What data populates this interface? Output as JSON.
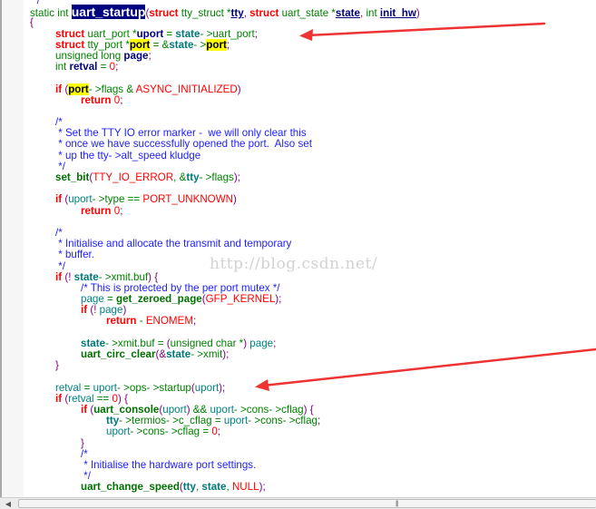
{
  "watermark": "http://blog.csdn.net/",
  "colors": {
    "keyword": "#ff0000",
    "comment": "#2020ff",
    "text": "#008000",
    "identifier": "#008080",
    "highlight": "#ffff00",
    "selection": "#000080",
    "arrow": "#ee3333"
  },
  "scrollbar": {
    "left_arrow_icon": "◀",
    "grip": "|||"
  },
  "code": {
    "lines": [
      [
        [
          "cm",
          " */"
        ]
      ],
      [
        [
          "tx",
          "static int "
        ],
        [
          "sel",
          "uart_startup"
        ],
        [
          "pu",
          "("
        ],
        [
          "kw",
          "struct"
        ],
        [
          "tx",
          " tty_struct *"
        ],
        [
          "ul",
          "tty"
        ],
        [
          "pu",
          ","
        ],
        [
          "tx",
          " "
        ],
        [
          "kw",
          "struct"
        ],
        [
          "tx",
          " uart_state *"
        ],
        [
          "ul",
          "state"
        ],
        [
          "pu",
          ","
        ],
        [
          "tx",
          " int "
        ],
        [
          "ul",
          "init_hw"
        ],
        [
          "pu",
          ")"
        ]
      ],
      [
        [
          "pu",
          "{"
        ]
      ],
      [
        [
          "tx",
          "\t"
        ],
        [
          "kw",
          "struct"
        ],
        [
          "tx",
          " uart_port *"
        ],
        [
          "bid",
          "uport"
        ],
        [
          "tx",
          " = "
        ],
        [
          "bt",
          "state"
        ],
        [
          "tx",
          "- >uart_port"
        ],
        [
          "pu",
          ";"
        ]
      ],
      [
        [
          "tx",
          "\t"
        ],
        [
          "kw",
          "struct"
        ],
        [
          "tx",
          " tty_port *"
        ],
        [
          "hl",
          "port"
        ],
        [
          "tx",
          " = &"
        ],
        [
          "bt",
          "state"
        ],
        [
          "tx",
          "- >"
        ],
        [
          "hl",
          "port"
        ],
        [
          "pu",
          ";"
        ]
      ],
      [
        [
          "tx",
          "\tunsigned long "
        ],
        [
          "bid",
          "page"
        ],
        [
          "pu",
          ";"
        ]
      ],
      [
        [
          "tx",
          "\tint "
        ],
        [
          "bid",
          "retval"
        ],
        [
          "tx",
          " = "
        ],
        [
          "num",
          "0"
        ],
        [
          "pu",
          ";"
        ]
      ],
      [],
      [
        [
          "tx",
          "\t"
        ],
        [
          "kw",
          "if"
        ],
        [
          "tx",
          " "
        ],
        [
          "pu",
          "("
        ],
        [
          "hl",
          "port"
        ],
        [
          "tx",
          "- >flags & "
        ],
        [
          "cst",
          "ASYNC_INITIALIZED"
        ],
        [
          "pu",
          ")"
        ]
      ],
      [
        [
          "tx",
          "\t\t"
        ],
        [
          "kw",
          "return"
        ],
        [
          "tx",
          " "
        ],
        [
          "num",
          "0"
        ],
        [
          "pu",
          ";"
        ]
      ],
      [],
      [
        [
          "cm",
          "\t/*"
        ]
      ],
      [
        [
          "cm",
          "\t * Set the TTY IO error marker -  we will only clear this"
        ]
      ],
      [
        [
          "cm",
          "\t * once we have successfully opened the port.  Also set"
        ]
      ],
      [
        [
          "cm",
          "\t * up the tty- >alt_speed kludge"
        ]
      ],
      [
        [
          "cm",
          "\t */"
        ]
      ],
      [
        [
          "tx",
          "\t"
        ],
        [
          "fn",
          "set_bit"
        ],
        [
          "pu",
          "("
        ],
        [
          "cst",
          "TTY_IO_ERROR"
        ],
        [
          "tx",
          ", &"
        ],
        [
          "bt",
          "tty"
        ],
        [
          "tx",
          "- >flags"
        ],
        [
          "pu",
          ");"
        ]
      ],
      [],
      [
        [
          "tx",
          "\t"
        ],
        [
          "kw",
          "if"
        ],
        [
          "tx",
          " "
        ],
        [
          "pu",
          "("
        ],
        [
          "id",
          "uport"
        ],
        [
          "tx",
          "- >type == "
        ],
        [
          "cst",
          "PORT_UNKNOWN"
        ],
        [
          "pu",
          ")"
        ]
      ],
      [
        [
          "tx",
          "\t\t"
        ],
        [
          "kw",
          "return"
        ],
        [
          "tx",
          " "
        ],
        [
          "num",
          "0"
        ],
        [
          "pu",
          ";"
        ]
      ],
      [],
      [
        [
          "cm",
          "\t/*"
        ]
      ],
      [
        [
          "cm",
          "\t * Initialise and allocate the transmit and temporary"
        ]
      ],
      [
        [
          "cm",
          "\t * buffer."
        ]
      ],
      [
        [
          "cm",
          "\t */"
        ]
      ],
      [
        [
          "tx",
          "\t"
        ],
        [
          "kw",
          "if"
        ],
        [
          "tx",
          " "
        ],
        [
          "pu",
          "(! "
        ],
        [
          "bt",
          "state"
        ],
        [
          "tx",
          "- >xmit.buf"
        ],
        [
          "pu",
          ")"
        ],
        [
          "tx",
          " "
        ],
        [
          "pu",
          "{"
        ]
      ],
      [
        [
          "cm",
          "\t\t/* This is protected by the per port mutex */"
        ]
      ],
      [
        [
          "tx",
          "\t\t"
        ],
        [
          "id",
          "page"
        ],
        [
          "tx",
          " = "
        ],
        [
          "fn",
          "get_zeroed_page"
        ],
        [
          "pu",
          "("
        ],
        [
          "cst",
          "GFP_KERNEL"
        ],
        [
          "pu",
          ");"
        ]
      ],
      [
        [
          "tx",
          "\t\t"
        ],
        [
          "kw",
          "if"
        ],
        [
          "tx",
          " "
        ],
        [
          "pu",
          "(! "
        ],
        [
          "id",
          "page"
        ],
        [
          "pu",
          ")"
        ]
      ],
      [
        [
          "tx",
          "\t\t\t"
        ],
        [
          "kw",
          "return"
        ],
        [
          "tx",
          " - "
        ],
        [
          "cst",
          "ENOMEM"
        ],
        [
          "pu",
          ";"
        ]
      ],
      [],
      [
        [
          "tx",
          "\t\t"
        ],
        [
          "bt",
          "state"
        ],
        [
          "tx",
          "- >xmit.buf = "
        ],
        [
          "pu",
          "("
        ],
        [
          "tx",
          "unsigned char *"
        ],
        [
          "pu",
          ")"
        ],
        [
          "tx",
          " "
        ],
        [
          "id",
          "page"
        ],
        [
          "pu",
          ";"
        ]
      ],
      [
        [
          "tx",
          "\t\t"
        ],
        [
          "fn",
          "uart_circ_clear"
        ],
        [
          "pu",
          "(&"
        ],
        [
          "bt",
          "state"
        ],
        [
          "tx",
          "- >xmit"
        ],
        [
          "pu",
          ");"
        ]
      ],
      [
        [
          "tx",
          "\t"
        ],
        [
          "pu",
          "}"
        ]
      ],
      [],
      [
        [
          "tx",
          "\t"
        ],
        [
          "id",
          "retval"
        ],
        [
          "tx",
          " = "
        ],
        [
          "id",
          "uport"
        ],
        [
          "tx",
          "- >ops- >startup"
        ],
        [
          "pu",
          "("
        ],
        [
          "id",
          "uport"
        ],
        [
          "pu",
          ");"
        ]
      ],
      [
        [
          "tx",
          "\t"
        ],
        [
          "kw",
          "if"
        ],
        [
          "tx",
          " "
        ],
        [
          "pu",
          "("
        ],
        [
          "id",
          "retval"
        ],
        [
          "tx",
          " == "
        ],
        [
          "num",
          "0"
        ],
        [
          "pu",
          ")"
        ],
        [
          "tx",
          " "
        ],
        [
          "pu",
          "{"
        ]
      ],
      [
        [
          "tx",
          "\t\t"
        ],
        [
          "kw",
          "if"
        ],
        [
          "tx",
          " "
        ],
        [
          "pu",
          "("
        ],
        [
          "fn",
          "uart_console"
        ],
        [
          "pu",
          "("
        ],
        [
          "id",
          "uport"
        ],
        [
          "pu",
          ")"
        ],
        [
          "tx",
          " && "
        ],
        [
          "id",
          "uport"
        ],
        [
          "tx",
          "- >cons- >cflag"
        ],
        [
          "pu",
          ")"
        ],
        [
          "tx",
          " "
        ],
        [
          "pu",
          "{"
        ]
      ],
      [
        [
          "tx",
          "\t\t\t"
        ],
        [
          "bt",
          "tty"
        ],
        [
          "tx",
          "- >termios- >c_cflag = "
        ],
        [
          "id",
          "uport"
        ],
        [
          "tx",
          "- >cons- >cflag"
        ],
        [
          "pu",
          ";"
        ]
      ],
      [
        [
          "tx",
          "\t\t\t"
        ],
        [
          "id",
          "uport"
        ],
        [
          "tx",
          "- >cons- >cflag = "
        ],
        [
          "num",
          "0"
        ],
        [
          "pu",
          ";"
        ]
      ],
      [
        [
          "tx",
          "\t\t"
        ],
        [
          "pu",
          "}"
        ]
      ],
      [
        [
          "cm",
          "\t\t/*"
        ]
      ],
      [
        [
          "cm",
          "\t\t * Initialise the hardware port settings."
        ]
      ],
      [
        [
          "cm",
          "\t\t */"
        ]
      ],
      [
        [
          "tx",
          "\t\t"
        ],
        [
          "fn",
          "uart_change_speed"
        ],
        [
          "pu",
          "("
        ],
        [
          "bt",
          "tty"
        ],
        [
          "tx",
          ", "
        ],
        [
          "bt",
          "state"
        ],
        [
          "tx",
          ", "
        ],
        [
          "cst",
          "NULL"
        ],
        [
          "pu",
          ");"
        ]
      ]
    ]
  }
}
